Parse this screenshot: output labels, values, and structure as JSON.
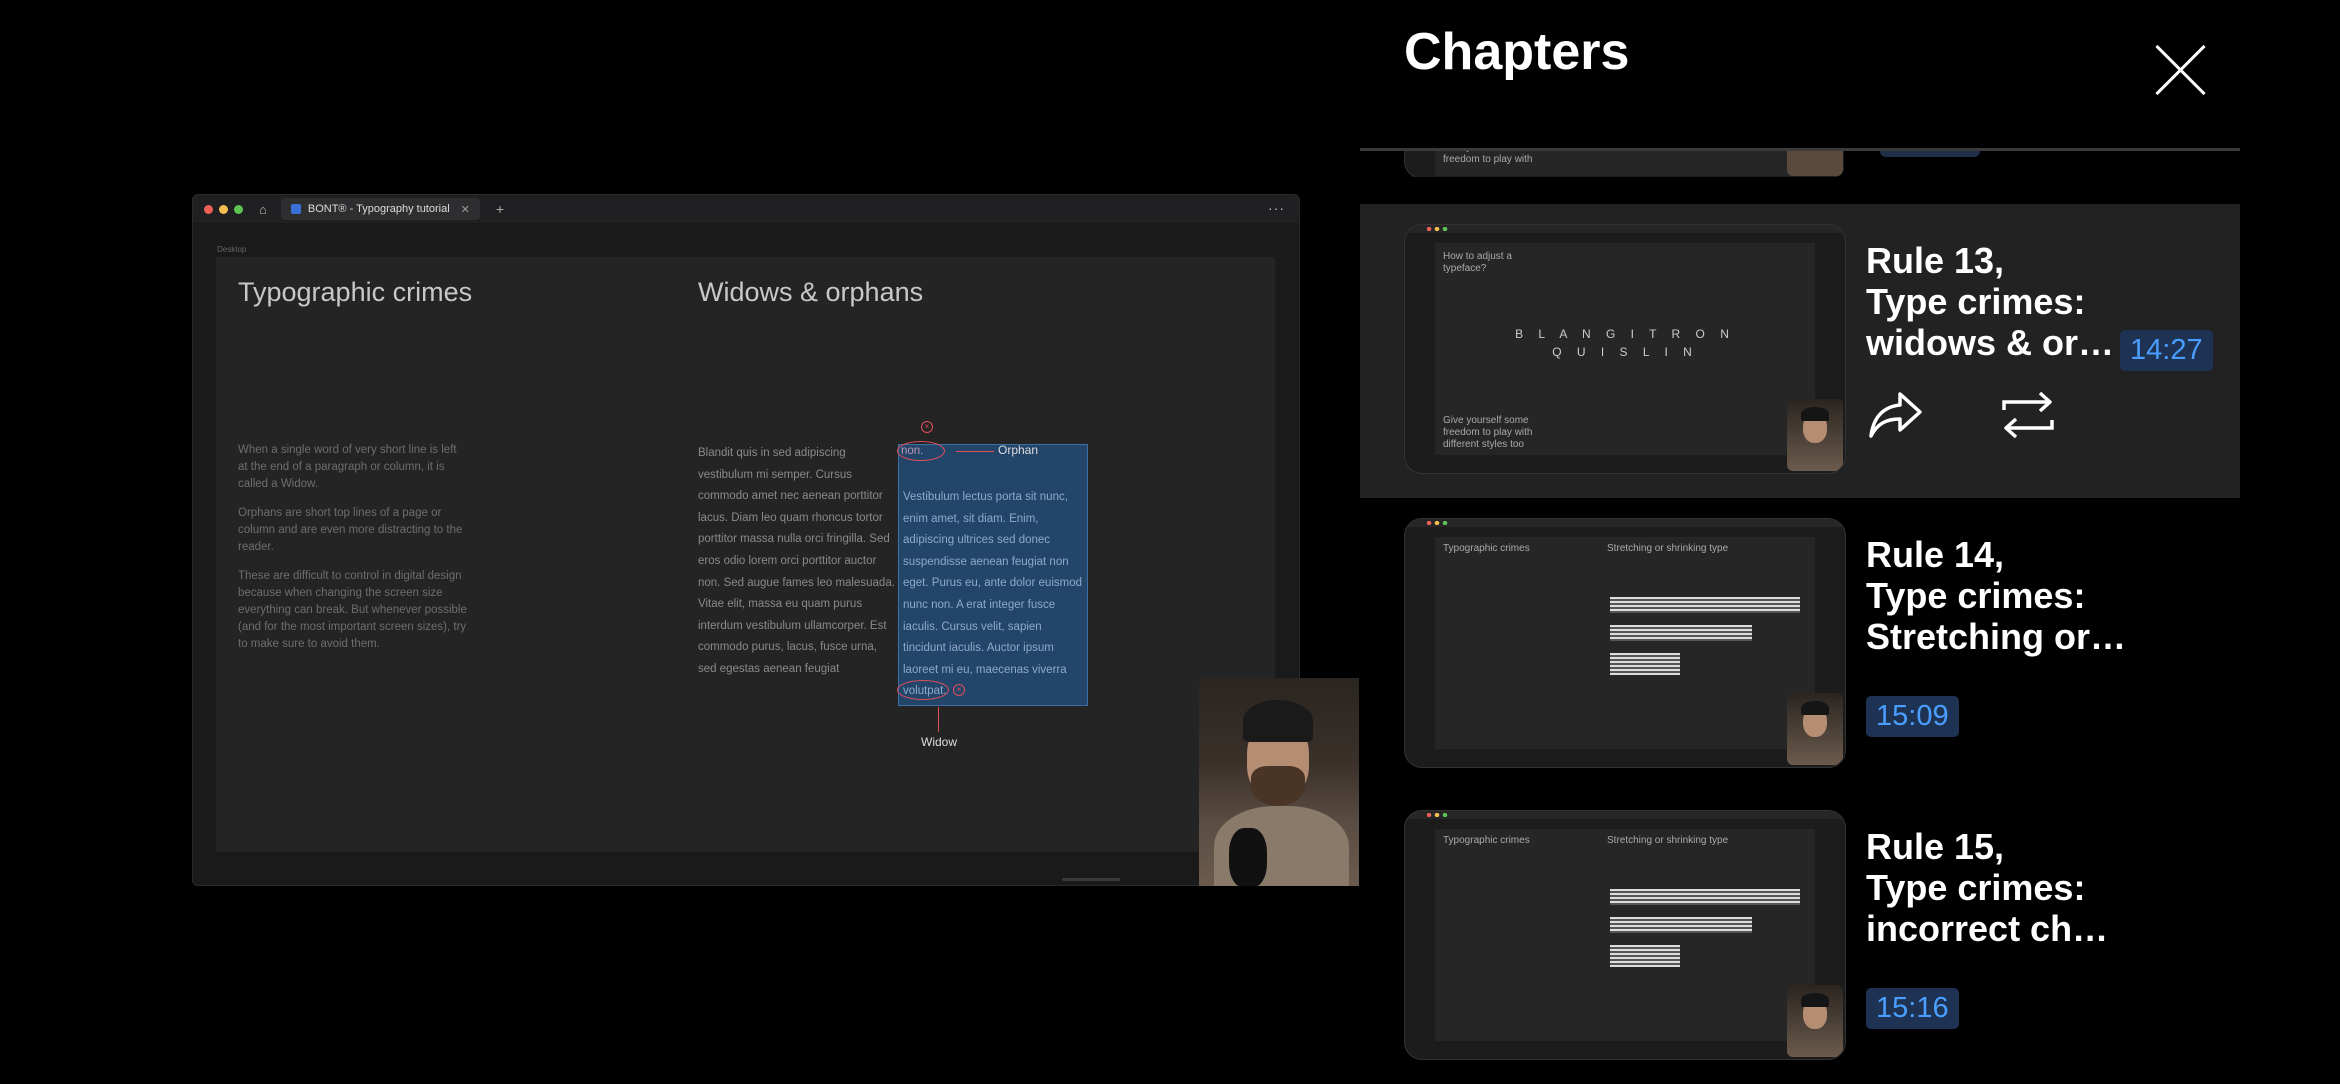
{
  "video": {
    "browser": {
      "tab_title": "BONT® - Typography tutorial",
      "tab_close": "✕",
      "new_tab": "+",
      "more": "···",
      "home_icon": "home-icon"
    },
    "breadcrumb": "Desktop",
    "artboard": {
      "left_title": "Typographic crimes",
      "right_title": "Widows & orphans",
      "left_paragraphs": [
        "When a single word of very short line is left at the end of a paragraph or column, it is called a Widow.",
        "Orphans are short top lines of a page or column and are even more distracting to the reader.",
        "These are difficult to control in digital design because when changing the screen size everything can break. But whenever possible (and for the most important screen sizes), try to make sure to avoid them."
      ],
      "body_text": "Blandit quis in sed adipiscing vestibulum mi semper. Cursus commodo amet nec aenean porttitor lacus. Diam leo quam rhoncus tortor porttitor massa nulla orci fringilla. Sed eros odio lorem orci porttitor auctor non. Sed augue fames leo malesuada. Vitae elit, massa eu quam purus interdum vestibulum ullamcorper. Est commodo purus, lacus, fusce urna, sed egestas aenean feugiat",
      "highlight_first_word": "non.",
      "highlight_text": "Vestibulum lectus porta sit nunc, enim amet, sit diam. Enim, adipiscing ultrices sed donec suspendisse aenean feugiat non eget. Purus eu, ante dolor euismod nunc non. A erat integer fusce iaculis. Cursus velit, sapien tincidunt iaculis. Auctor ipsum laoreet mi eu, maecenas viverra volutpat.",
      "orphan_label": "Orphan",
      "widow_label": "Widow"
    }
  },
  "panel": {
    "title": "Chapters",
    "close_icon": "close-icon",
    "peek_text": "Give yourself some freedom to play with",
    "chapters": [
      {
        "title": "Rule 13,\nType crimes:\nwidows & or…",
        "time": "14:27",
        "active": true,
        "thumb_heading": "How to adjust a typeface?",
        "thumb_logo": "B L A N G I T R O N\nQ U I S  L I N",
        "thumb_footer": "Give yourself some freedom to play with different styles too",
        "share_icon": "share-icon",
        "loop_icon": "loop-icon"
      },
      {
        "title": "Rule 14,\nType crimes:\nStretching or…",
        "time": "15:09",
        "active": false,
        "thumb_left": "Typographic crimes",
        "thumb_right": "Stretching or shrinking type"
      },
      {
        "title": "Rule 15,\nType crimes:\nincorrect ch…",
        "time": "15:16",
        "active": false,
        "thumb_left": "Typographic crimes",
        "thumb_right": "Stretching or shrinking type"
      }
    ]
  },
  "colors": {
    "accent_time": "#4a9eff",
    "time_bg": "#1e3353",
    "active_row_bg": "#222222",
    "annotation_red": "#e0505a",
    "highlight_blue": "#24456a"
  }
}
